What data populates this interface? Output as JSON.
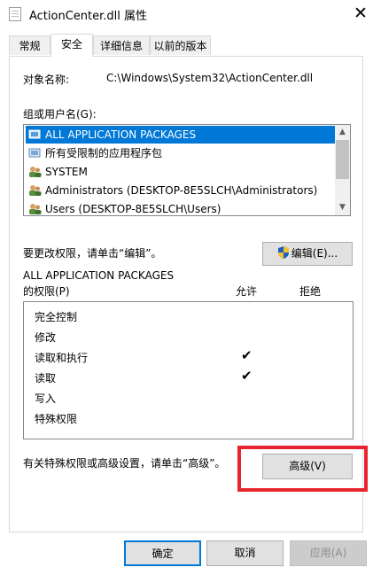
{
  "window": {
    "title": "ActionCenter.dll 属性",
    "close_glyph": "✕"
  },
  "tabs": [
    {
      "label": "常规",
      "active": false
    },
    {
      "label": "安全",
      "active": true
    },
    {
      "label": "详细信息",
      "active": false
    },
    {
      "label": "以前的版本",
      "active": false
    }
  ],
  "security": {
    "object_name_label": "对象名称:",
    "object_name_value": "C:\\Windows\\System32\\ActionCenter.dll",
    "groups_label": "组或用户名(G):",
    "users": [
      {
        "name": "ALL APPLICATION PACKAGES",
        "icon": "package-group-icon",
        "selected": true
      },
      {
        "name": "所有受限制的应用程序包",
        "icon": "package-group-icon",
        "selected": false
      },
      {
        "name": "SYSTEM",
        "icon": "users-icon",
        "selected": false
      },
      {
        "name": "Administrators (DESKTOP-8E5SLCH\\Administrators)",
        "icon": "users-icon",
        "selected": false
      },
      {
        "name": "Users (DESKTOP-8E5SLCH\\Users)",
        "icon": "users-icon",
        "selected": false
      }
    ],
    "edit_hint": "要更改权限，请单击“编辑”。",
    "edit_button": "编辑(E)...",
    "perm_owner": "ALL APPLICATION PACKAGES",
    "perm_label": "的权限(P)",
    "col_allow": "允许",
    "col_deny": "拒绝",
    "permissions": [
      {
        "name": "完全控制",
        "allow": false,
        "deny": false
      },
      {
        "name": "修改",
        "allow": false,
        "deny": false
      },
      {
        "name": "读取和执行",
        "allow": true,
        "deny": false
      },
      {
        "name": "读取",
        "allow": true,
        "deny": false
      },
      {
        "name": "写入",
        "allow": false,
        "deny": false
      },
      {
        "name": "特殊权限",
        "allow": false,
        "deny": false
      }
    ],
    "check_glyph": "✔",
    "advanced_hint": "有关特殊权限或高级设置，请单击“高级”。",
    "advanced_button": "高级(V)"
  },
  "footer": {
    "ok": "确定",
    "cancel": "取消",
    "apply": "应用(A)"
  },
  "colors": {
    "selection": "#0078d7",
    "highlight_frame": "#e8242c"
  }
}
